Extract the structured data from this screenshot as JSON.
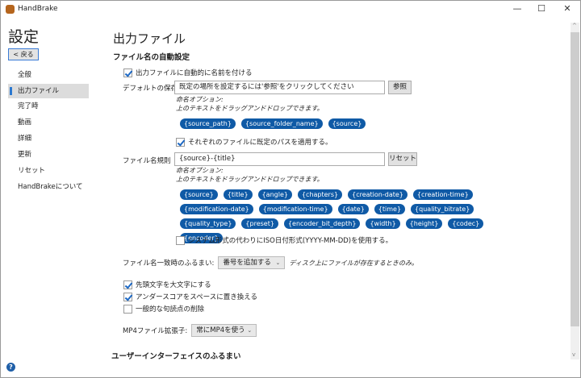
{
  "window": {
    "title": "HandBrake",
    "minimize": "—",
    "maximize": "☐",
    "close": "✕"
  },
  "sidebar": {
    "title": "設定",
    "back": "< 戻る",
    "items": [
      {
        "label": "全般"
      },
      {
        "label": "出力ファイル",
        "selected": true
      },
      {
        "label": "完了時"
      },
      {
        "label": "動画"
      },
      {
        "label": "詳細"
      },
      {
        "label": "更新"
      },
      {
        "label": "リセット"
      },
      {
        "label": "HandBrakeについて"
      }
    ],
    "help": "?"
  },
  "main": {
    "title": "出力ファイル",
    "section1": "ファイル名の自動設定",
    "auto_name": {
      "label": "出力ファイルに自動的に名前を付ける",
      "checked": true
    },
    "default_path": {
      "label": "デフォルトの保存先",
      "value": "既定の場所を設定するには'参照'をクリックしてください",
      "button": "参照"
    },
    "hint1": "命名オプション:",
    "hint2": "上のテキストをドラッグアンドドロップできます。",
    "path_chips": [
      "{source_path}",
      "{source_folder_name}",
      "{source}"
    ],
    "apply_path": {
      "label": "それぞれのファイルに既定のパスを適用する。",
      "checked": true
    },
    "file_format": {
      "label": "ファイル名規則",
      "value": "{source}-{title}",
      "button": "リセット"
    },
    "name_chips": [
      "{source}",
      "{title}",
      "{angle}",
      "{chapters}",
      "{creation-date}",
      "{creation-time}",
      "{modification-date}",
      "{modification-time}",
      "{date}",
      "{time}",
      "{quality_bitrate}",
      "{quality_type}",
      "{preset}",
      "{encoder_bit_depth}",
      "{width}",
      "{height}",
      "{codec}",
      "{encoder}"
    ],
    "iso_date": {
      "label": "システム形式の代わりにISO日付形式(YYYY-MM-DD)を使用する。",
      "checked": false
    },
    "collision": {
      "label": "ファイル名一致時のふるまい:",
      "value": "番号を追加する",
      "hint": "ディスク上にファイルが存在するときのみ。"
    },
    "capitalize": {
      "label": "先頭文字を大文字にする",
      "checked": true
    },
    "underscore": {
      "label": "アンダースコアをスペースに置き換える",
      "checked": true
    },
    "punctuation": {
      "label": "一般的な句読点の削除",
      "checked": false
    },
    "mp4": {
      "label": "MP4ファイル拡張子:",
      "value": "常にMP4を使う"
    },
    "section2": "ユーザーインターフェイスのふるまい"
  }
}
